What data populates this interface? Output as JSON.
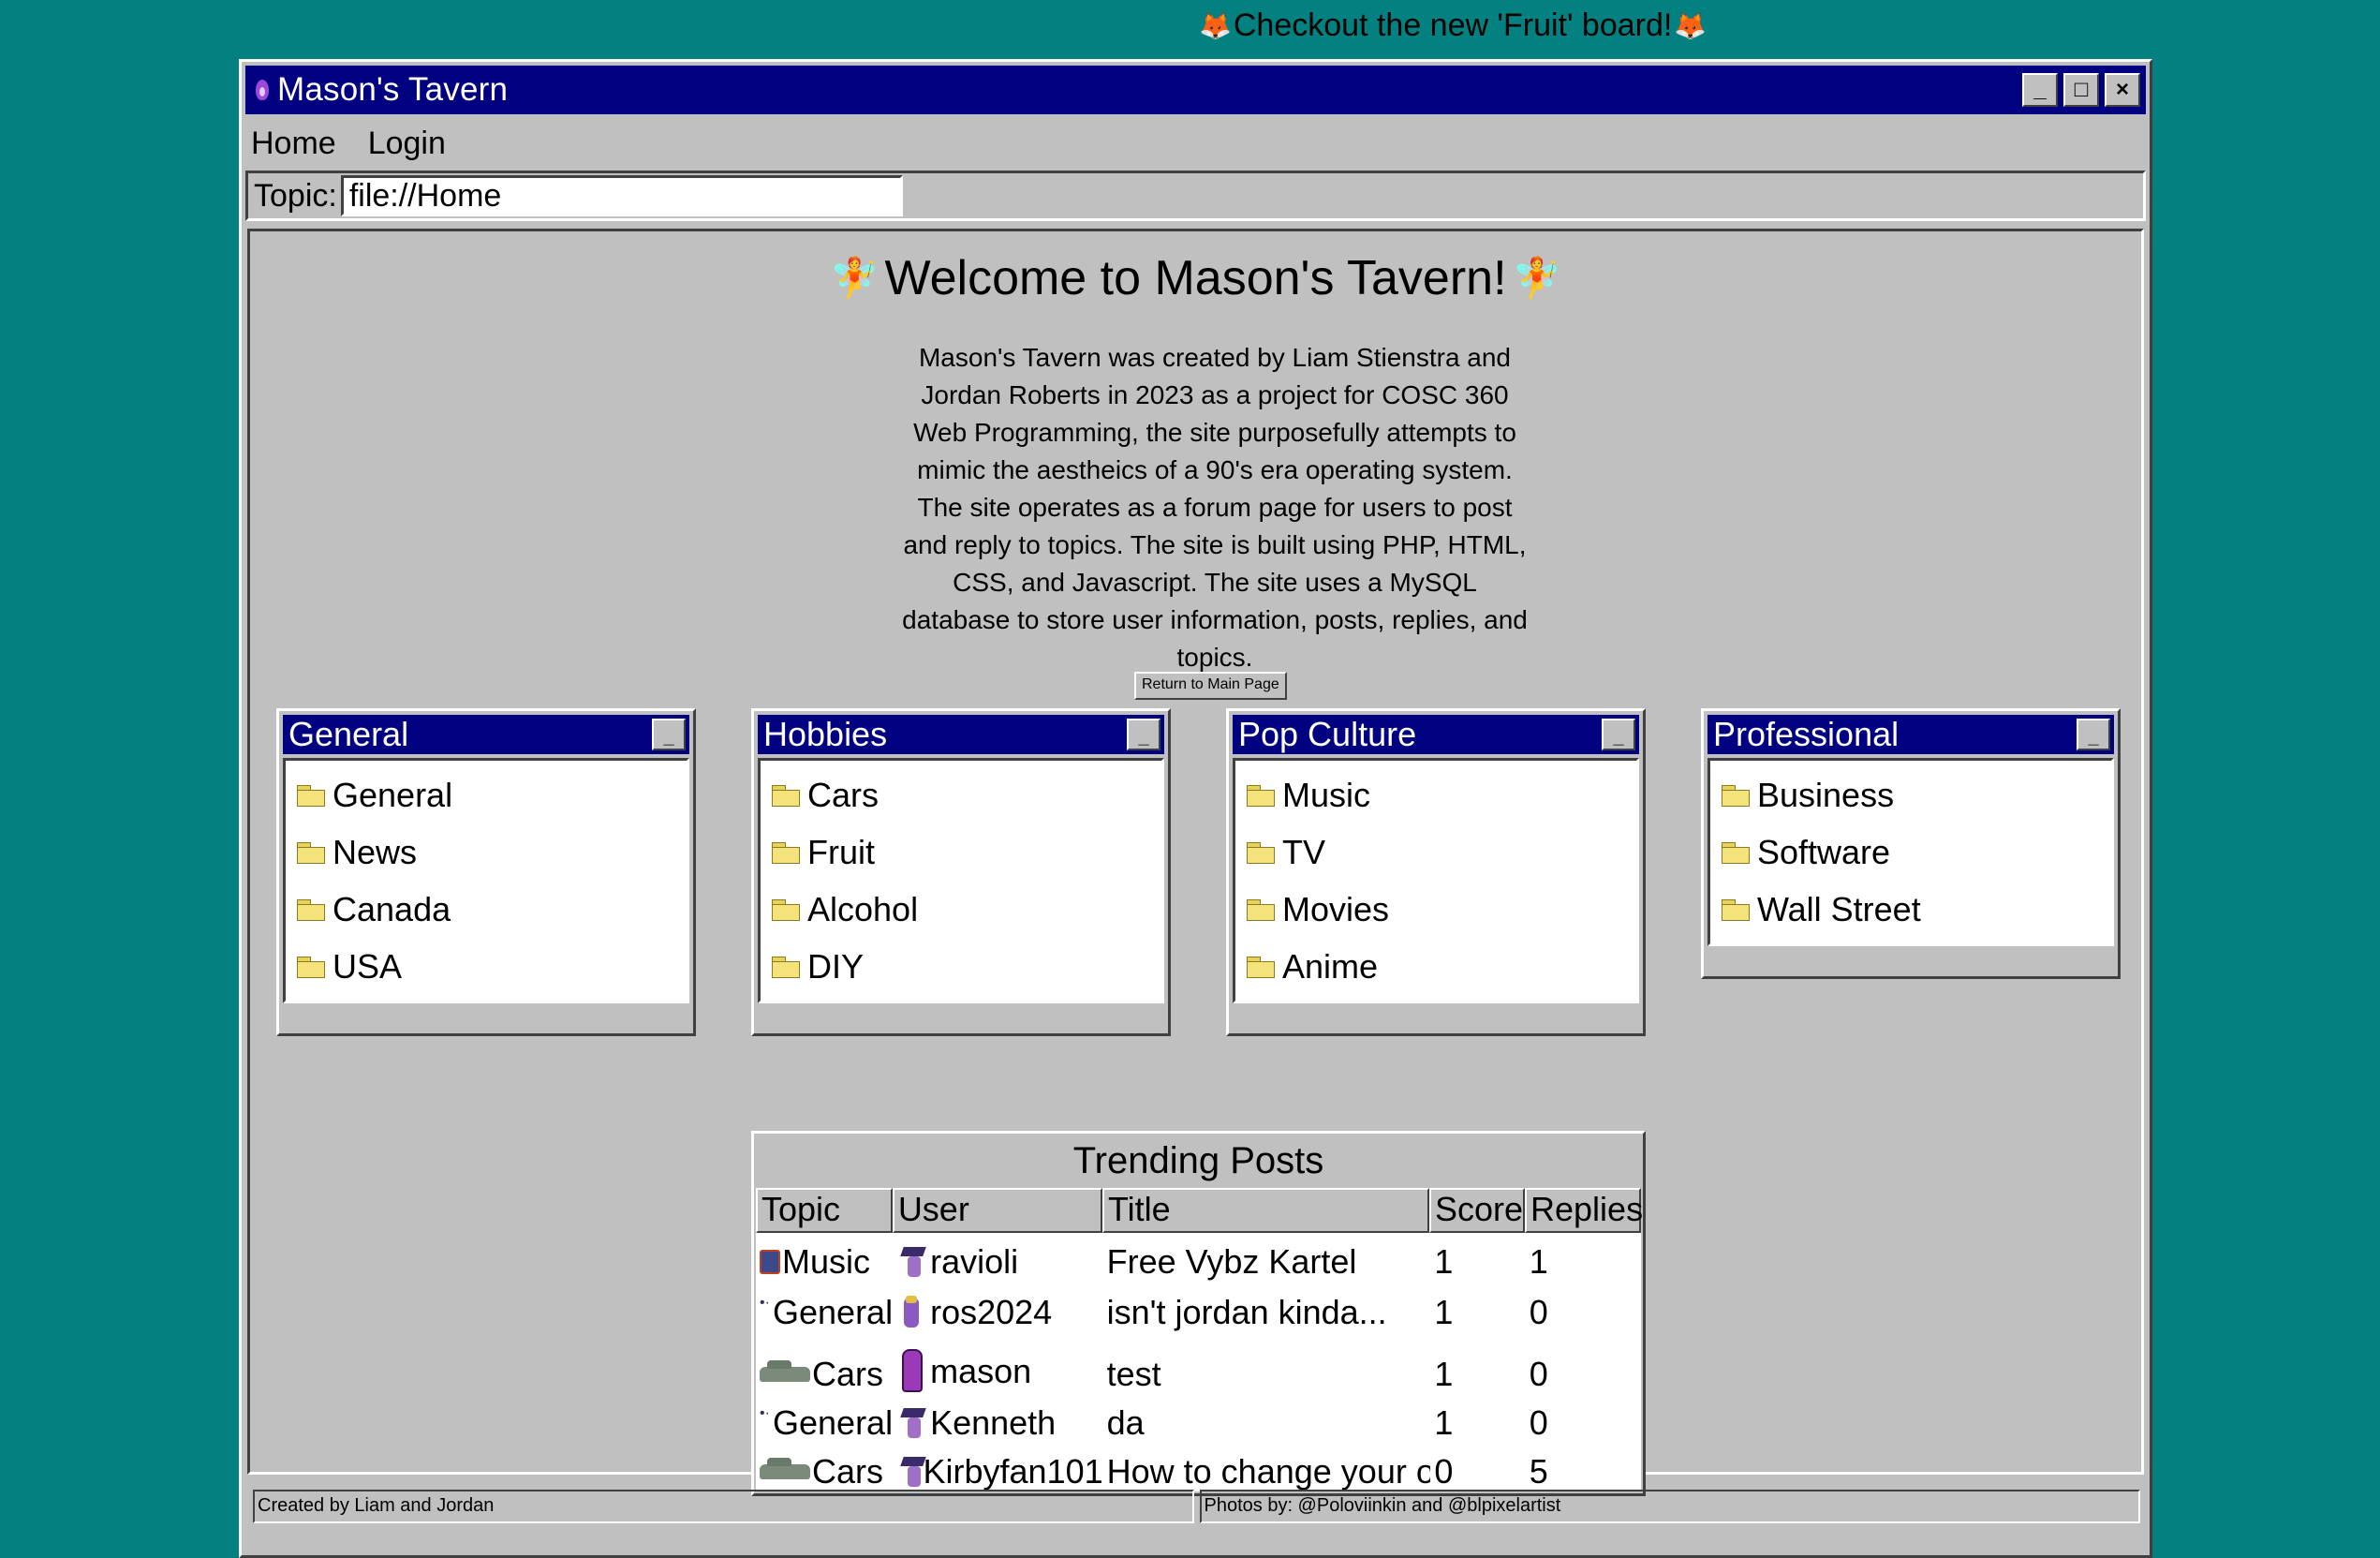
{
  "announcement": {
    "text": "Checkout the new 'Fruit' board!"
  },
  "window": {
    "title": "Mason's Tavern"
  },
  "menu": {
    "home": "Home",
    "login": "Login"
  },
  "topic_bar": {
    "label": "Topic:",
    "value": "file://Home"
  },
  "welcome": {
    "heading": "Welcome to Mason's Tavern!"
  },
  "about": {
    "text": "Mason's Tavern was created by Liam Stienstra and Jordan Roberts in 2023 as a project for COSC 360 Web Programming, the site purposefully attempts to mimic the aestheics of a 90's era operating system. The site operates as a forum page for users to post and reply to topics. The site is built using PHP, HTML, CSS, and Javascript. The site uses a MySQL database to store user information, posts, replies, and topics."
  },
  "return_button": {
    "label": "Return to Main Page"
  },
  "categories": [
    {
      "title": "General",
      "items": [
        "General",
        "News",
        "Canada",
        "USA"
      ]
    },
    {
      "title": "Hobbies",
      "items": [
        "Cars",
        "Fruit",
        "Alcohol",
        "DIY"
      ]
    },
    {
      "title": "Pop Culture",
      "items": [
        "Music",
        "TV",
        "Movies",
        "Anime"
      ]
    },
    {
      "title": "Professional",
      "items": [
        "Business",
        "Software",
        "Wall Street"
      ]
    }
  ],
  "trending": {
    "title": "Trending Posts",
    "columns": [
      "Topic",
      "User",
      "Title",
      "Score",
      "Replies"
    ],
    "rows": [
      {
        "topic": "Music",
        "topic_icon": "music-icon",
        "user": "ravioli",
        "avatar": "witch-avatar",
        "title": "Free Vybz Kartel",
        "score": "1",
        "replies": "1"
      },
      {
        "topic": "General",
        "topic_icon": "general-icon",
        "user": "ros2024",
        "avatar": "wizard-avatar",
        "title": "isn't jordan kinda...",
        "score": "1",
        "replies": "0"
      },
      {
        "topic": "Cars",
        "topic_icon": "car-icon",
        "user": "mason",
        "avatar": "cloak-avatar",
        "title": "test",
        "score": "1",
        "replies": "0"
      },
      {
        "topic": "General",
        "topic_icon": "general-icon",
        "user": "Kenneth",
        "avatar": "witch-avatar",
        "title": "da",
        "score": "1",
        "replies": "0"
      },
      {
        "topic": "Cars",
        "topic_icon": "car-icon",
        "user": "Kirbyfan101",
        "avatar": "witch-avatar",
        "title": "How to change your o...",
        "score": "0",
        "replies": "5"
      }
    ]
  },
  "status": {
    "left": "Created by Liam and Jordan",
    "right": "Photos by: @Poloviinkin and @blpixelartist"
  },
  "colors": {
    "desktop": "#038080",
    "titlebar": "#000080",
    "window": "#c0c0c0"
  }
}
